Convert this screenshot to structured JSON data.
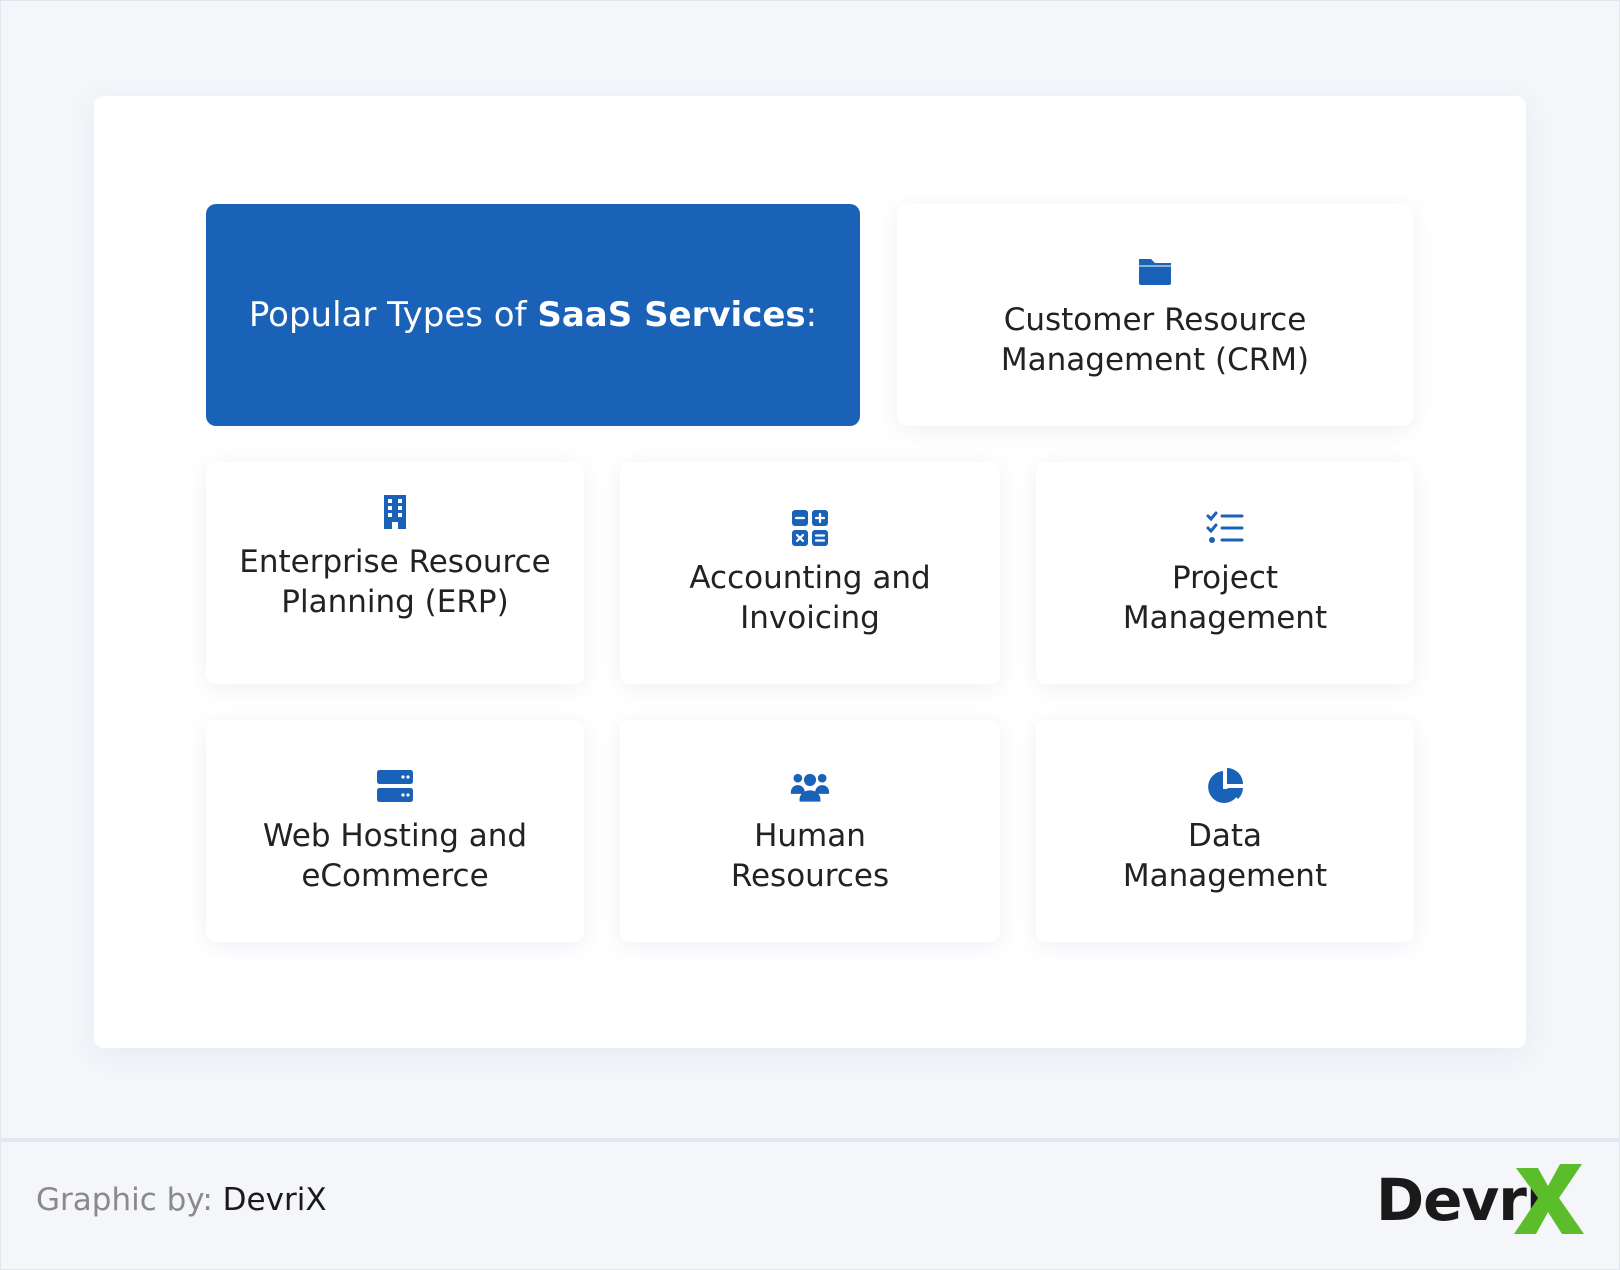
{
  "title": {
    "prefix": "Popular Types of ",
    "bold": "SaaS Services",
    "suffix": ":"
  },
  "colors": {
    "accent": "#1a62b7",
    "logo_x": "#5bbd2a"
  },
  "cards": [
    {
      "icon": "folder-icon",
      "label": "Customer Resource\nManagement (CRM)"
    },
    {
      "icon": "building-icon",
      "label": "Enterprise Resource\nPlanning (ERP)"
    },
    {
      "icon": "calculator-icon",
      "label": "Accounting and\nInvoicing"
    },
    {
      "icon": "checklist-icon",
      "label": "Project\nManagement"
    },
    {
      "icon": "server-icon",
      "label": "Web Hosting and\neCommerce"
    },
    {
      "icon": "users-icon",
      "label": "Human\nResources"
    },
    {
      "icon": "pie-chart-icon",
      "label": "Data\nManagement"
    }
  ],
  "footer": {
    "credit_prefix": "Graphic by: ",
    "credit_brand": "DevriX",
    "logo_text": "Devri"
  }
}
